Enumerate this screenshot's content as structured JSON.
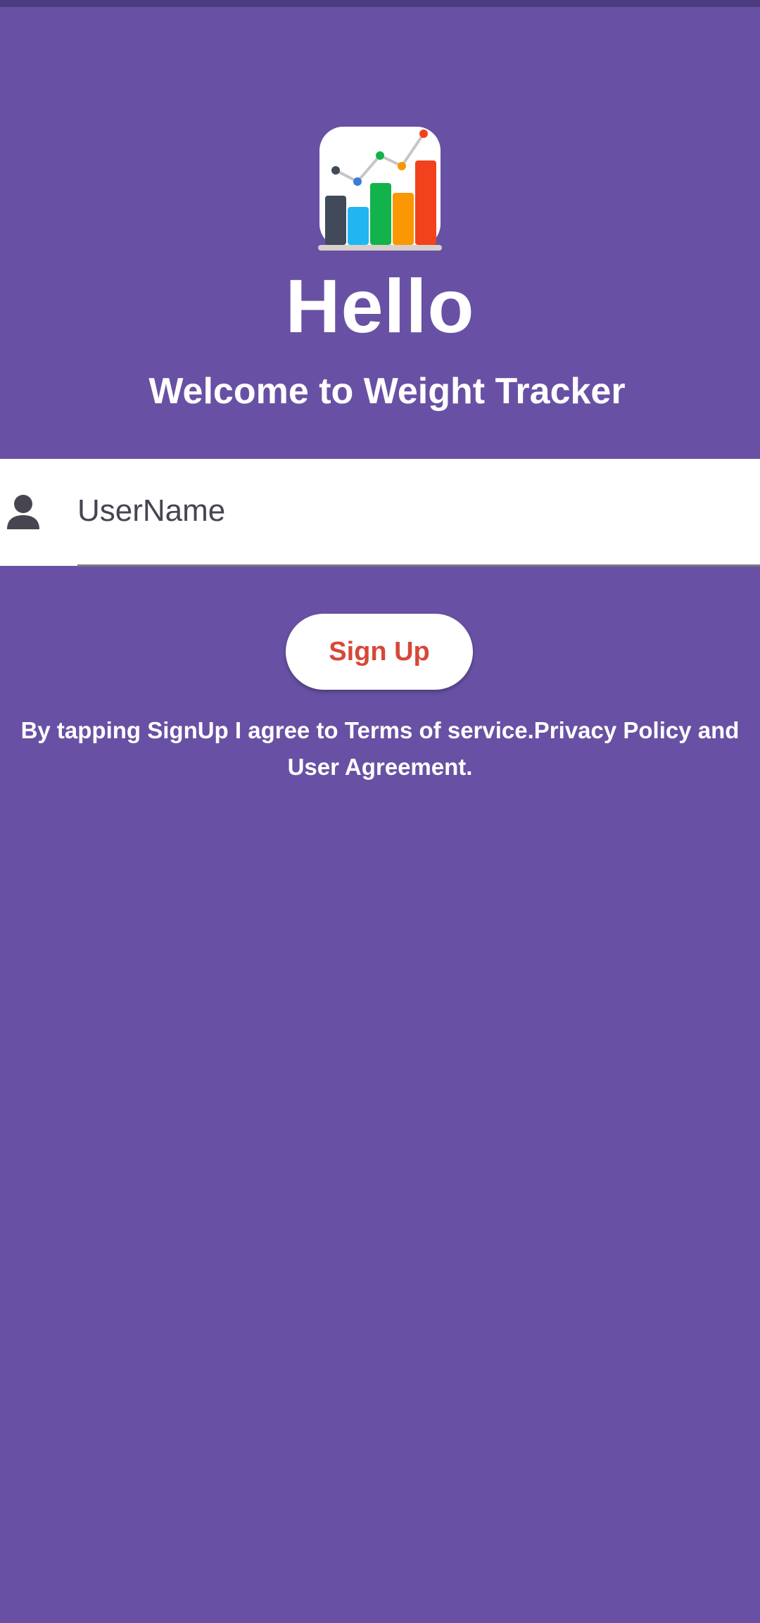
{
  "screen": {
    "background_color": "#6851a4",
    "status_bar_color": "#4d3b80"
  },
  "logo": {
    "icon": "bar-chart-app-icon"
  },
  "header": {
    "title": "Hello",
    "subtitle": "Welcome to Weight Tracker"
  },
  "form": {
    "username_icon": "person-icon",
    "username_placeholder": "UserName",
    "username_value": ""
  },
  "actions": {
    "signup_label": "Sign Up",
    "signup_text_color": "#d54839"
  },
  "legal": {
    "terms_text": "By tapping SignUp I agree to Terms of service.Privacy Policy and User Agreement."
  }
}
